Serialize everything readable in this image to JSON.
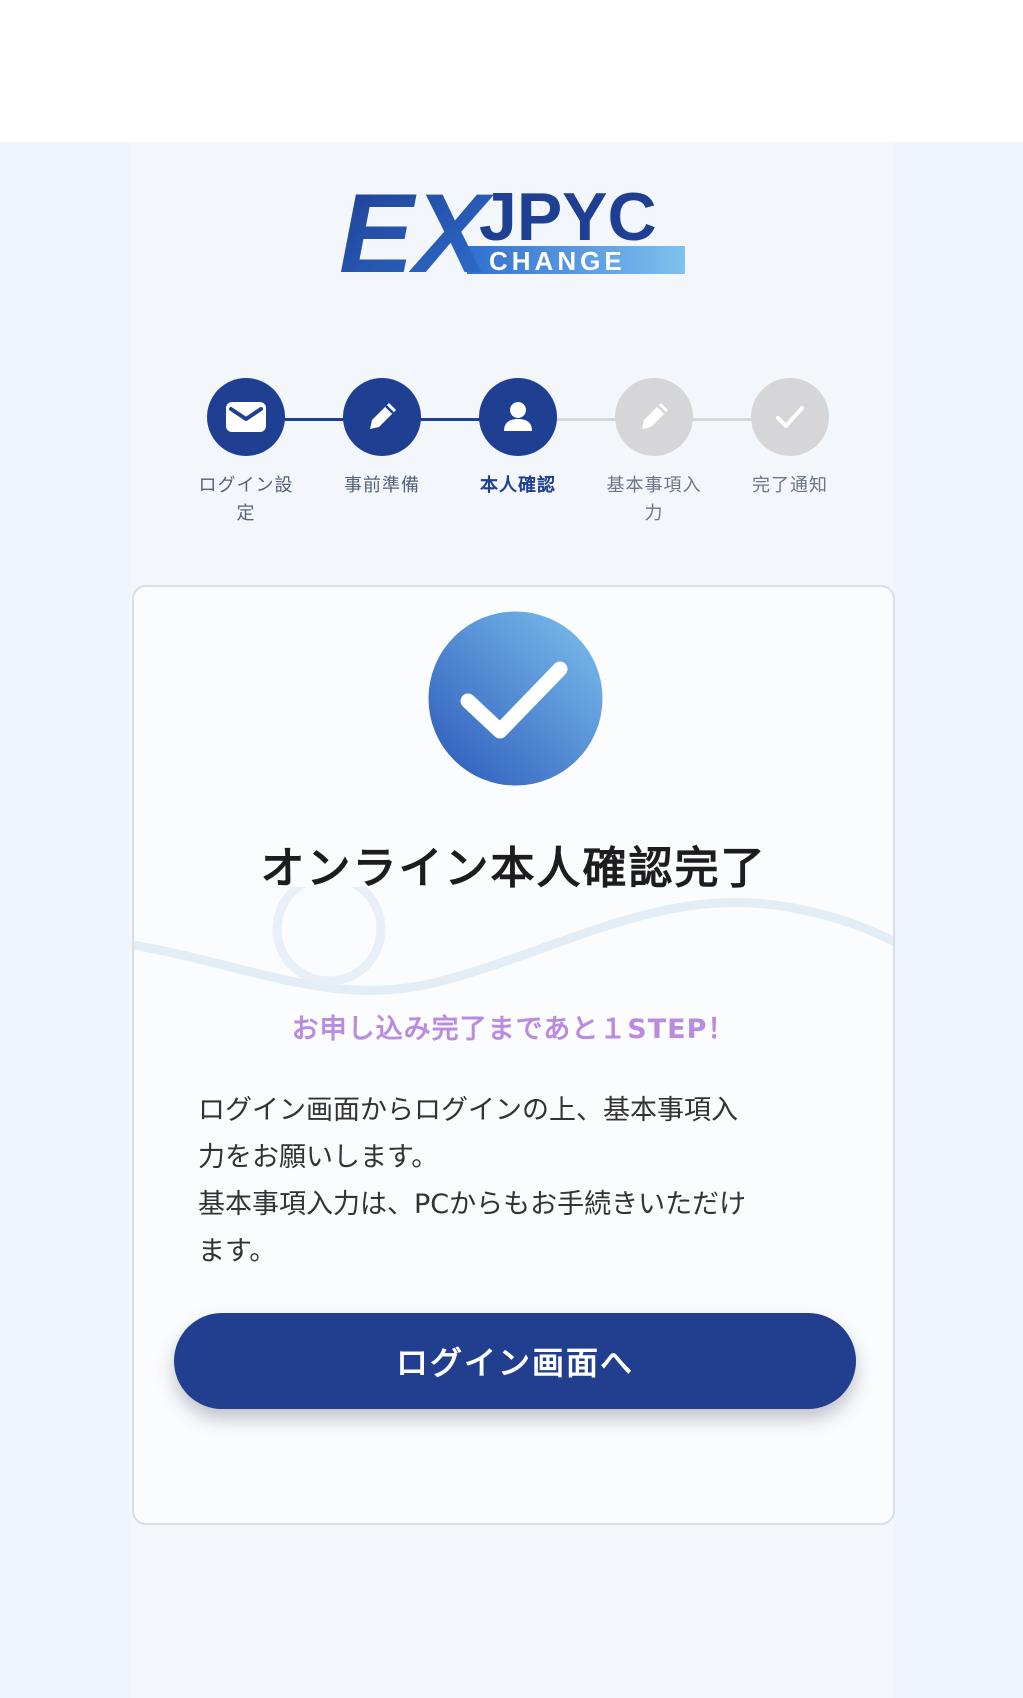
{
  "brand": {
    "logo_ex": "EX",
    "logo_jpyc": "JPYC",
    "logo_change": "CHANGE"
  },
  "stepper": {
    "steps": [
      {
        "label_line1": "ログイン設",
        "label_line2": "定",
        "icon": "mail-icon",
        "state": "done"
      },
      {
        "label_line1": "事前準備",
        "label_line2": "",
        "icon": "pencil-icon",
        "state": "done"
      },
      {
        "label_line1": "本人確認",
        "label_line2": "",
        "icon": "user-icon",
        "state": "current"
      },
      {
        "label_line1": "基本事項入",
        "label_line2": "力",
        "icon": "pencil-icon",
        "state": "todo"
      },
      {
        "label_line1": "完了通知",
        "label_line2": "",
        "icon": "check-icon",
        "state": "todo"
      }
    ]
  },
  "card": {
    "badge_icon": "check-icon",
    "title": "オンライン本人確認完了",
    "subtitle": "お申し込み完了まであと１STEP！",
    "body_line1": "ログイン画面からログインの上、基本事項入",
    "body_line2": "力をお願いします。",
    "body_line3": "基本事項入力は、PCからもお手続きいただけ",
    "body_line4": "ます。",
    "button_label": "ログイン画面へ"
  },
  "colors": {
    "primary": "#213e8f",
    "step_inactive": "#d6d6d8",
    "subtitle_accent": "#b98ce0",
    "background": "#eef4fa"
  }
}
